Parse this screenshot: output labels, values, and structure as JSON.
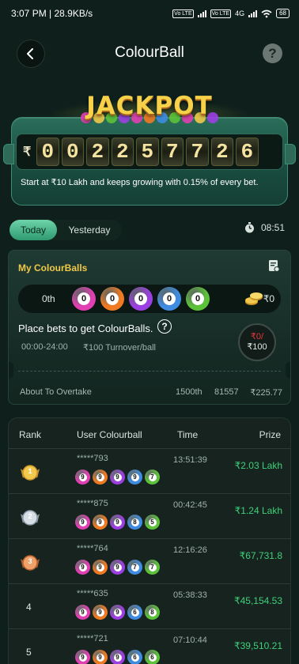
{
  "status_bar": {
    "left": "3:07 PM | 28.9KB/s",
    "sim1": "Vo LTE",
    "sim2": "Vo LTE",
    "net": "4G",
    "battery": "68"
  },
  "header": {
    "title": "ColourBall",
    "help": "?"
  },
  "jackpot": {
    "title": "JACKPOT",
    "currency": "₹",
    "digits": [
      "0",
      "0",
      "2",
      "2",
      "5",
      "7",
      "7",
      "2",
      "6"
    ],
    "description": "Start at ₹10 Lakh and keeps growing with 0.15% of every bet."
  },
  "tabs": {
    "today": "Today",
    "yesterday": "Yesterday"
  },
  "timer": "08:51",
  "my_colourballs": {
    "title": "My ColourBalls",
    "rank": "0th",
    "balls": [
      {
        "num": "0",
        "color": "#e23fb3"
      },
      {
        "num": "0",
        "color": "#f07a22"
      },
      {
        "num": "0",
        "color": "#9b3fe2"
      },
      {
        "num": "0",
        "color": "#3f8ce2"
      },
      {
        "num": "0",
        "color": "#5cc23a"
      }
    ],
    "coin_value": "₹0",
    "place_text": "Place bets to get ColourBalls.",
    "help": "?",
    "time_range": "00:00-24:00",
    "turnover": "₹100 Turnover/ball",
    "progress_current": "₹0/",
    "progress_max": "₹100",
    "progress": 0,
    "overtake_label": "About To Overtake",
    "overtake_rank": "1500th",
    "overtake_number": "81557",
    "overtake_amount": "₹225.77"
  },
  "leaderboard": {
    "headers": {
      "rank": "Rank",
      "user": "User Colourball",
      "time": "Time",
      "prize": "Prize"
    },
    "rows": [
      {
        "rank": "1",
        "medal": "gold",
        "user": "*****793",
        "balls": [
          "9",
          "9",
          "9",
          "9",
          "7"
        ],
        "time": "13:51:39",
        "prize": "₹2.03 Lakh"
      },
      {
        "rank": "2",
        "medal": "silver",
        "user": "*****875",
        "balls": [
          "9",
          "9",
          "9",
          "8",
          "5"
        ],
        "time": "00:42:45",
        "prize": "₹1.24 Lakh"
      },
      {
        "rank": "3",
        "medal": "bronze",
        "user": "*****764",
        "balls": [
          "9",
          "9",
          "9",
          "7",
          "7"
        ],
        "time": "12:16:26",
        "prize": "₹67,731.8"
      },
      {
        "rank": "4",
        "medal": "",
        "user": "*****635",
        "balls": [
          "9",
          "9",
          "9",
          "6",
          "8"
        ],
        "time": "05:38:33",
        "prize": "₹45,154.53"
      },
      {
        "rank": "5",
        "medal": "",
        "user": "*****721",
        "balls": [
          "9",
          "9",
          "9",
          "6",
          "6"
        ],
        "time": "07:10:44",
        "prize": "₹39,510.21"
      }
    ],
    "ball_colors": [
      "#e23fb3",
      "#f07a22",
      "#9b3fe2",
      "#3f8ce2",
      "#5cc23a"
    ]
  },
  "colors": {
    "accent_green": "#3fd07a",
    "gold": "#f0c948",
    "background": "#0f1f1b"
  }
}
